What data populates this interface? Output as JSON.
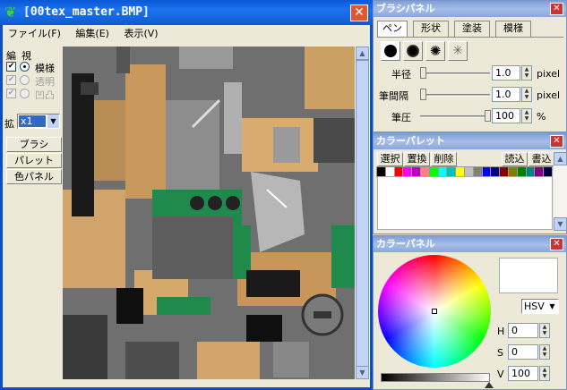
{
  "main_window": {
    "title": "[00tex_master.BMP]",
    "menu": [
      "ファイル(F)",
      "編集(E)",
      "表示(V)"
    ]
  },
  "left_tools": {
    "edit_label": "編",
    "view_label": "視",
    "checks": [
      {
        "label": "模様",
        "checked": true
      },
      {
        "label": "透明",
        "checked": true
      },
      {
        "label": "凹凸",
        "checked": true
      }
    ],
    "zoom_label": "拡",
    "zoom_value": "x1",
    "panel_buttons": [
      "ブラシ",
      "パレット",
      "色パネル"
    ]
  },
  "brush_panel": {
    "title": "ブラシパネル",
    "tabs": [
      "ペン",
      "形状",
      "塗装",
      "模様"
    ],
    "shapes": [
      "round-brush-icon",
      "soft-brush-icon",
      "scatter-brush-icon",
      "spray-brush-icon"
    ],
    "radius_label": "半径",
    "radius_value": "1.0",
    "radius_unit": "pixel",
    "spacing_label": "筆間隔",
    "spacing_value": "1.0",
    "spacing_unit": "pixel",
    "pressure_label": "筆圧",
    "pressure_value": "100",
    "pressure_unit": "%"
  },
  "palette_panel": {
    "title": "カラーパレット",
    "buttons": [
      "選択",
      "置換",
      "削除",
      "読込",
      "書込"
    ],
    "swatches": [
      "#000000",
      "#ffffff",
      "#ff0000",
      "#ff00ff",
      "#c000c0",
      "#ff8080",
      "#00ff00",
      "#00ffff",
      "#00c0c0",
      "#ffff00",
      "#c0c0c0",
      "#808080",
      "#0000ff",
      "#000080",
      "#800000",
      "#808000",
      "#008000",
      "#008080",
      "#800080",
      "#000040"
    ]
  },
  "color_panel": {
    "title": "カラーパネル",
    "mode": "HSV",
    "h_label": "H",
    "h_value": "0",
    "s_label": "S",
    "s_value": "0",
    "v_label": "V",
    "v_value": "100",
    "current_color": "#ffffff"
  },
  "colors": {
    "title_blue": "#0a58d6",
    "panel_title": "#8aa8dd",
    "texture_tan": "#d4a86f",
    "texture_green": "#1f8a4c",
    "texture_gray": "#777777"
  }
}
